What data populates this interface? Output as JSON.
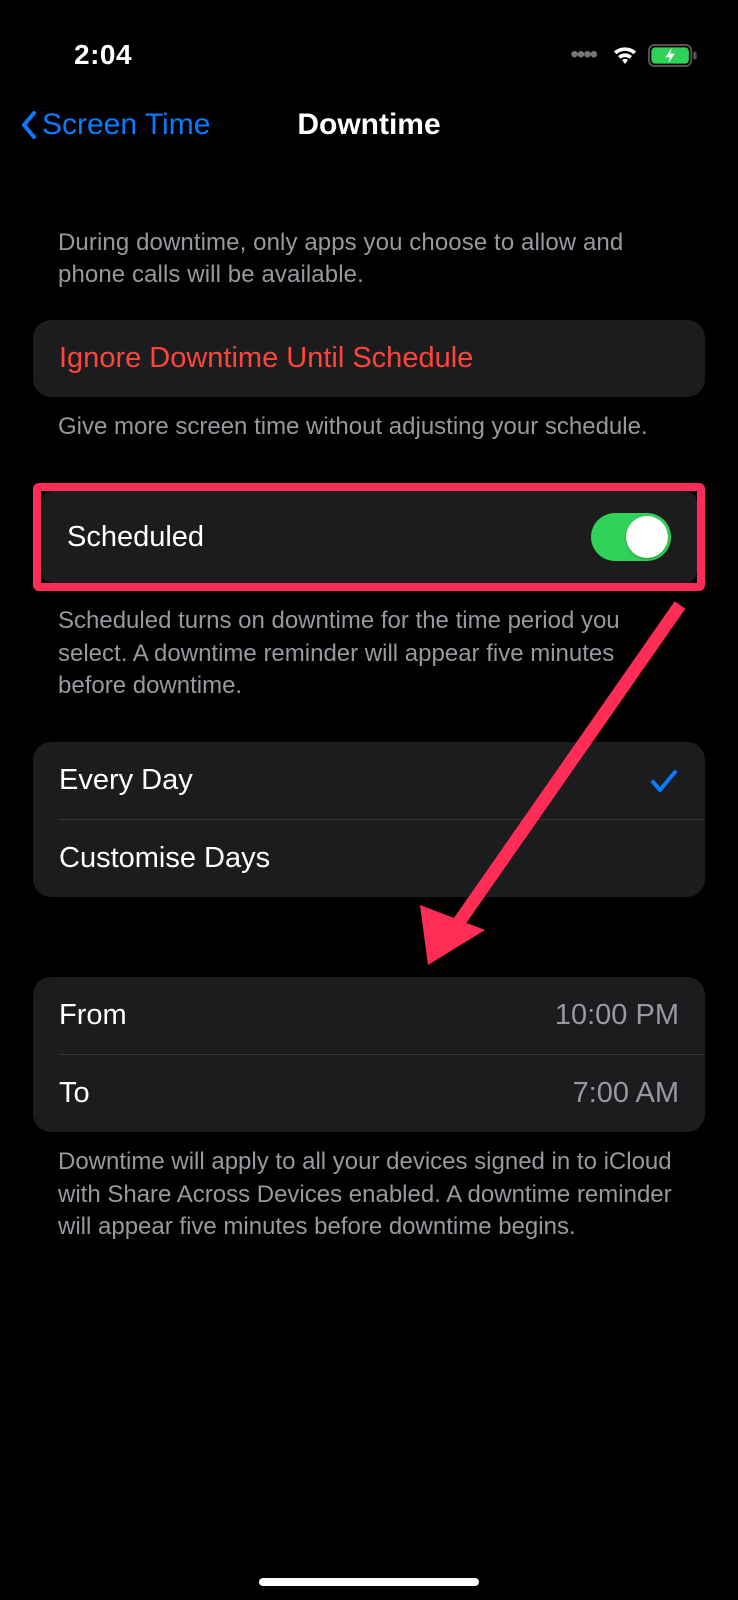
{
  "status": {
    "time": "2:04"
  },
  "nav": {
    "back": "Screen Time",
    "title": "Downtime"
  },
  "sections": {
    "intro": "During downtime, only apps you choose to allow and phone calls will be available.",
    "ignore_label": "Ignore Downtime Until Schedule",
    "ignore_footer": "Give more screen time without adjusting your schedule.",
    "scheduled_label": "Scheduled",
    "scheduled_footer": "Scheduled turns on downtime for the time period you select. A downtime reminder will appear five minutes before downtime.",
    "days": {
      "every": "Every Day",
      "custom": "Customise Days"
    },
    "time": {
      "from_label": "From",
      "from_value": "10:00 PM",
      "to_label": "To",
      "to_value": "7:00 AM"
    },
    "devices_footer": "Downtime will apply to all your devices signed in to iCloud with Share Across Devices enabled. A downtime reminder will appear five minutes before downtime begins."
  }
}
